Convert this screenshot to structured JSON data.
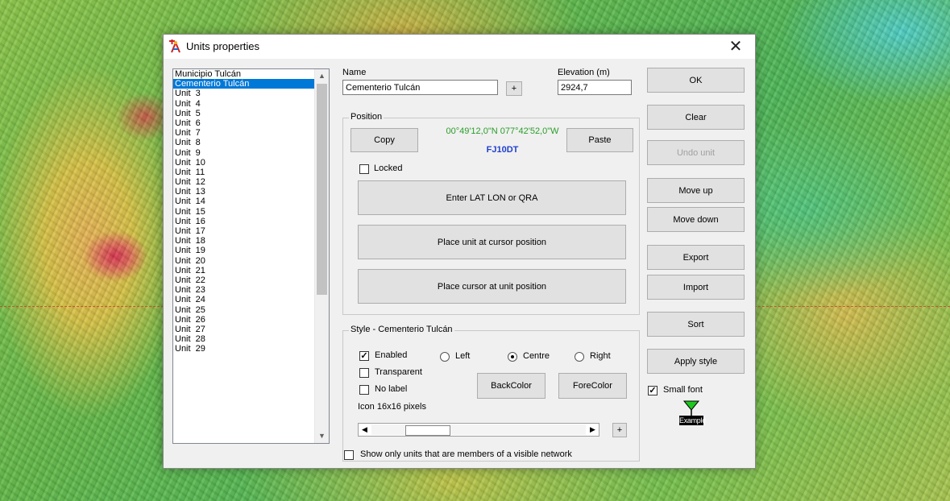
{
  "window": {
    "title": "Units properties",
    "close_glyph": "✕"
  },
  "units": [
    "Municipio Tulcán",
    "Cementerio Tulcán",
    "Unit  3",
    "Unit  4",
    "Unit  5",
    "Unit  6",
    "Unit  7",
    "Unit  8",
    "Unit  9",
    "Unit  10",
    "Unit  11",
    "Unit  12",
    "Unit  13",
    "Unit  14",
    "Unit  15",
    "Unit  16",
    "Unit  17",
    "Unit  18",
    "Unit  19",
    "Unit  20",
    "Unit  21",
    "Unit  22",
    "Unit  23",
    "Unit  24",
    "Unit  25",
    "Unit  26",
    "Unit  27",
    "Unit  28",
    "Unit  29"
  ],
  "selected_unit_index": 1,
  "name": {
    "label": "Name",
    "value": "Cementerio Tulcán",
    "plus": "+"
  },
  "elevation": {
    "label": "Elevation (m)",
    "value": "2924,7"
  },
  "position": {
    "group_title": "Position",
    "copy": "Copy",
    "paste": "Paste",
    "coords": "00°49'12,0\"N 077°42'52,0\"W",
    "qra": "FJ10DT",
    "locked_label": "Locked",
    "locked": false,
    "enter_latlon": "Enter LAT LON or QRA",
    "place_unit": "Place unit at cursor position",
    "place_cursor": "Place cursor at unit position"
  },
  "style": {
    "group_title": "Style - Cementerio Tulcán",
    "enabled_label": "Enabled",
    "enabled": true,
    "transparent_label": "Transparent",
    "transparent": false,
    "nolabel_label": "No label",
    "nolabel": false,
    "align_left": "Left",
    "align_centre": "Centre",
    "align_right": "Right",
    "align_selected": "Centre",
    "backcolor": "BackColor",
    "forecolor": "ForeColor",
    "icon_size_label": "Icon 16x16 pixels",
    "icon_size_level": 0.2,
    "plus": "+"
  },
  "show_only_label": "Show only units that are members of a visible network",
  "show_only": false,
  "buttons": {
    "ok": "OK",
    "clear": "Clear",
    "undo": "Undo unit",
    "move_up": "Move up",
    "move_down": "Move down",
    "export": "Export",
    "import": "Import",
    "sort": "Sort",
    "apply_style": "Apply style"
  },
  "small_font_label": "Small font",
  "small_font": true,
  "example_label": "Example",
  "colors": {
    "coords": "#2a9d2a",
    "qra": "#1f3fd0",
    "selection": "#0078d7",
    "example_icon": "#1fc71f"
  }
}
